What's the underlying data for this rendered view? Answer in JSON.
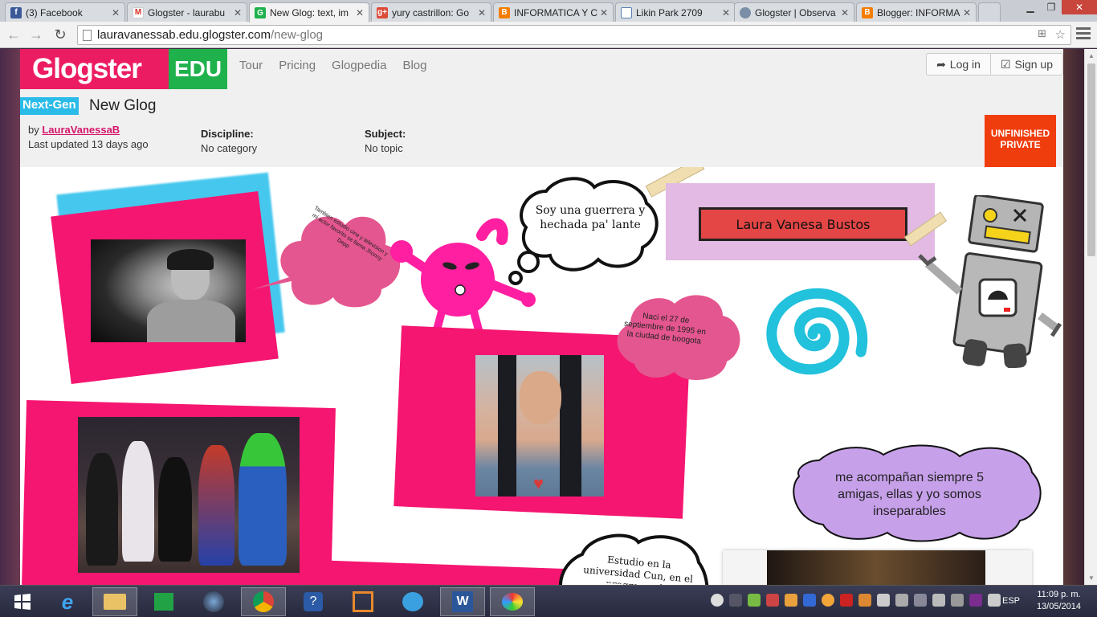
{
  "browser": {
    "tabs": [
      {
        "label": "(3) Facebook",
        "icon": "facebook-icon",
        "color": "#3b5998",
        "glyph": "f",
        "active": false
      },
      {
        "label": "Glogster - laurabu",
        "icon": "gmail-icon",
        "color": "#d93025",
        "glyph": "M",
        "active": false
      },
      {
        "label": "New Glog: text, im",
        "icon": "glogster-icon",
        "color": "#1fb14c",
        "glyph": "G",
        "active": true
      },
      {
        "label": "yury castrillon: Go",
        "icon": "google-plus-icon",
        "color": "#dd4b39",
        "glyph": "g+",
        "active": false
      },
      {
        "label": "INFORMATICA Y C",
        "icon": "blogger-icon",
        "color": "#f57d00",
        "glyph": "B",
        "active": false
      },
      {
        "label": "Likin Park 2709",
        "icon": "page-icon",
        "color": "#5b7fb5",
        "glyph": "",
        "active": false
      },
      {
        "label": "Glogster | Observa",
        "icon": "settings-icon",
        "color": "#7b8ea8",
        "glyph": "",
        "active": false
      },
      {
        "label": "Blogger: INFORMA",
        "icon": "blogger-icon",
        "color": "#f57d00",
        "glyph": "B",
        "active": false
      }
    ],
    "url_host": "lauravanessab.edu.glogster.com",
    "url_path": "/new-glog"
  },
  "site": {
    "logo_main": "Glogster",
    "logo_edu": "EDU",
    "nav": [
      "Tour",
      "Pricing",
      "Glogpedia",
      "Blog"
    ],
    "login": "Log in",
    "signup": "Sign up",
    "badge": "Next-Gen",
    "title": "New Glog",
    "by_prefix": "by",
    "author": "LauraVanessaB",
    "last_updated": "Last updated 13 days ago",
    "discipline_label": "Discipline:",
    "discipline_value": "No category",
    "subject_label": "Subject:",
    "subject_value": "No topic",
    "status_1": "UNFINISHED",
    "status_2": "PRIVATE"
  },
  "glog": {
    "bubble_johnny": "Tambien estudio cine y television y mi actor favorito se llama Jhonny Depp",
    "bubble_warrior": "Soy una guerrera y hechada pa' lante",
    "name_sign": "Laura Vanesa Bustos",
    "bubble_born": "Naci el 27 de septiembre de 1995 en la ciudad de boogota",
    "bubble_friends": "me acompañan siempre 5 amigas, ellas y yo somos inseparables",
    "bubble_study": "Estudio en la universidad Cun, en el programa de"
  },
  "taskbar": {
    "lang": "ESP",
    "time": "11:09 p. m.",
    "date": "13/05/2014"
  },
  "colors": {
    "glogster_pink": "#ec1c63",
    "glogster_green": "#1fb14c",
    "frame_pink": "#f51671",
    "cloud_pink": "#e4568f",
    "cloud_purple": "#c7a0ea",
    "status_red": "#f03d0e"
  }
}
